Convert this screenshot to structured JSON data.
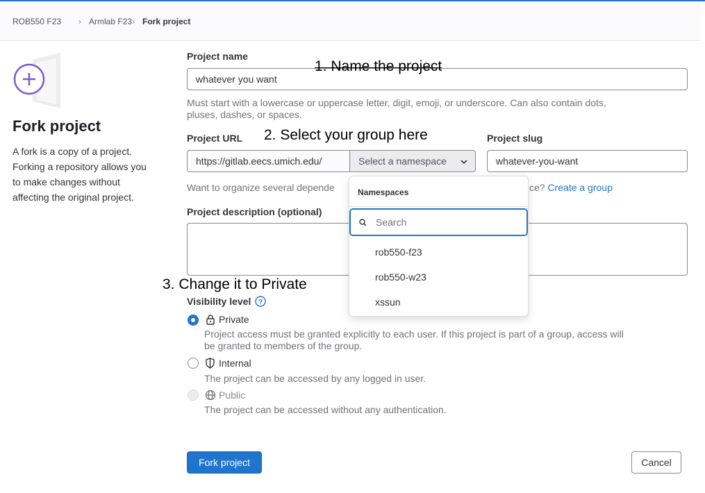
{
  "breadcrumb": {
    "items": [
      "ROB550 F23",
      "Armlab F23",
      "Fork project"
    ],
    "separator": "›"
  },
  "sidebar": {
    "title": "Fork project",
    "description": [
      "A fork is a copy of a project.",
      "Forking a repository allows you",
      "to make changes without",
      "affecting the original project."
    ],
    "illustration_icon": "fork-plus-illustration"
  },
  "form": {
    "project_name": {
      "label": "Project name",
      "value": "whatever you want",
      "help": [
        "Must start with a lowercase or uppercase letter, digit, emoji, or underscore. Can also contain dots,",
        "pluses, dashes, or spaces."
      ]
    },
    "project_url": {
      "label": "Project URL",
      "prefix": "https://gitlab.eecs.umich.edu/",
      "namespace_placeholder": "Select a namespace"
    },
    "project_slug": {
      "label": "Project slug",
      "value": "whatever-you-want"
    },
    "organize_help": {
      "text_start": "Want to organize several depende",
      "text_end": "ce?",
      "link": "Create a group"
    },
    "description": {
      "label": "Project description (optional)",
      "value": ""
    },
    "visibility": {
      "label": "Visibility level",
      "options": [
        {
          "label": "Private",
          "description": [
            "Project access must be granted explicitly to each user. If this project is part of a group, access will",
            "be granted to members of the group."
          ],
          "selected": true,
          "disabled": false,
          "icon": "lock-icon"
        },
        {
          "label": "Internal",
          "description": [
            "The project can be accessed by any logged in user."
          ],
          "selected": false,
          "disabled": false,
          "icon": "shield-icon"
        },
        {
          "label": "Public",
          "description": [
            "The project can be accessed without any authentication."
          ],
          "selected": false,
          "disabled": true,
          "icon": "globe-icon"
        }
      ]
    },
    "submit_label": "Fork project",
    "cancel_label": "Cancel"
  },
  "namespace_dropdown": {
    "header": "Namespaces",
    "search_placeholder": "Search",
    "items": [
      "rob550-f23",
      "rob550-w23",
      "xssun"
    ]
  },
  "annotations": [
    "1. Name the project",
    "2. Select your group here",
    "3. Change it to Private"
  ],
  "colors": {
    "accent": "#1f75cb",
    "purple": "#7b58cf",
    "text": "#333238",
    "muted": "#737278"
  }
}
